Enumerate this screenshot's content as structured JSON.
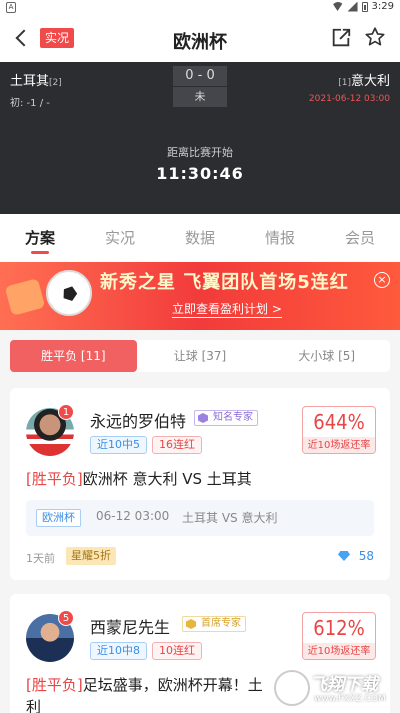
{
  "statusbar": {
    "time": "3:29",
    "left_icon_label": "A"
  },
  "header": {
    "live_label": "实况",
    "title": "欧洲杯"
  },
  "match": {
    "home_team": "土耳其",
    "home_rank": "[2]",
    "away_team": "意大利",
    "away_rank": "[1]",
    "score": "0 - 0",
    "status": "未",
    "odds": "初: -1 / -",
    "datetime": "2021-06-12 03:00",
    "countdown_label": "距离比赛开始",
    "countdown": "11:30:46"
  },
  "tabs": [
    "方案",
    "实况",
    "数据",
    "情报",
    "会员"
  ],
  "banner": {
    "headline": "新秀之星 飞翼团队首场5连红",
    "sub": "立即查看盈利计划 >",
    "close": "×"
  },
  "filters": [
    "胜平负 [11]",
    "让球 [37]",
    "大小球 [5]"
  ],
  "cards": [
    {
      "rank": "1",
      "name": "永远的罗伯特",
      "tag": "知名专家",
      "stat1": "近10中5",
      "stat2": "16连红",
      "rate": "644%",
      "rate_label": "近10场返还率",
      "plan_type": "[胜平负]",
      "plan_text": "欧洲杯 意大利 VS 土耳其",
      "league": "欧洲杯",
      "match_time": "06-12  03:00",
      "match_teams": "土耳其 VS 意大利",
      "ago": "1天前",
      "discount": "星耀5折",
      "price": "58"
    },
    {
      "rank": "5",
      "name": "西蒙尼先生",
      "tag": "首席专家",
      "stat1": "近10中8",
      "stat2": "10连红",
      "rate": "612%",
      "rate_label": "近10场返还率",
      "plan_type": "[胜平负]",
      "plan_text": "足坛盛事，欧洲杯开幕！土",
      "plan_text2": "利"
    }
  ],
  "watermark": {
    "text": "飞翔下载",
    "url": "www.FXXZ.COM"
  },
  "colors": {
    "accent": "#f04a4a",
    "dark_header": "#2c2d31",
    "blue": "#3a8ee6"
  }
}
